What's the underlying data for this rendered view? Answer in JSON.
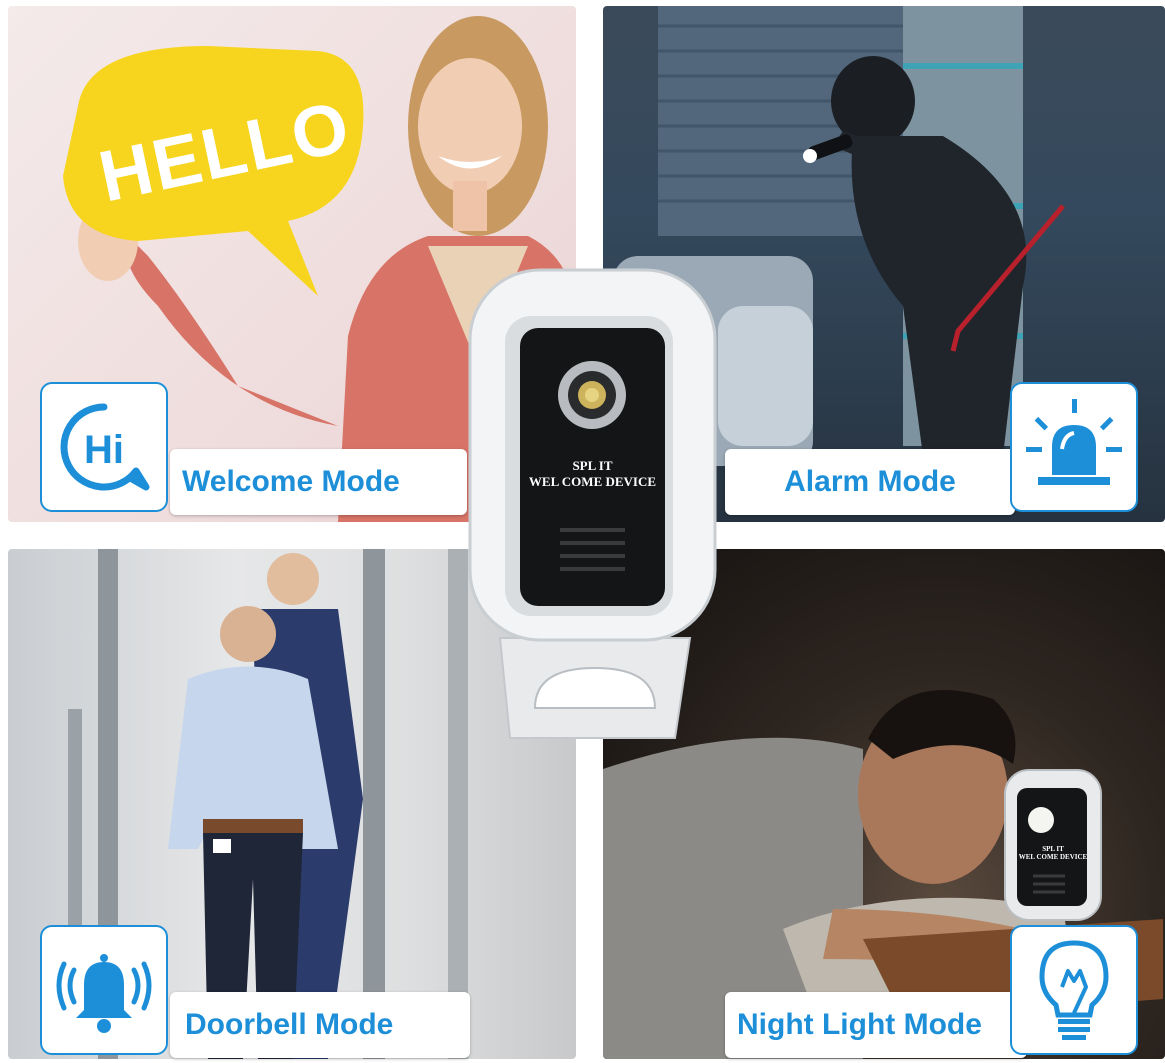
{
  "modes": [
    {
      "label": "Welcome Mode",
      "icon": "hi-speech-bubble-icon"
    },
    {
      "label": "Alarm Mode",
      "icon": "alarm-siren-icon"
    },
    {
      "label": "Doorbell Mode",
      "icon": "ringing-bell-icon"
    },
    {
      "label": "Night Light Mode",
      "icon": "light-bulb-icon"
    }
  ],
  "hello_sign": "HELLO",
  "hi_icon_text": "Hi",
  "device": {
    "line1": "SPL IT",
    "line2": "WEL COME DEVICE"
  },
  "accent_color": "#1d8fd8"
}
